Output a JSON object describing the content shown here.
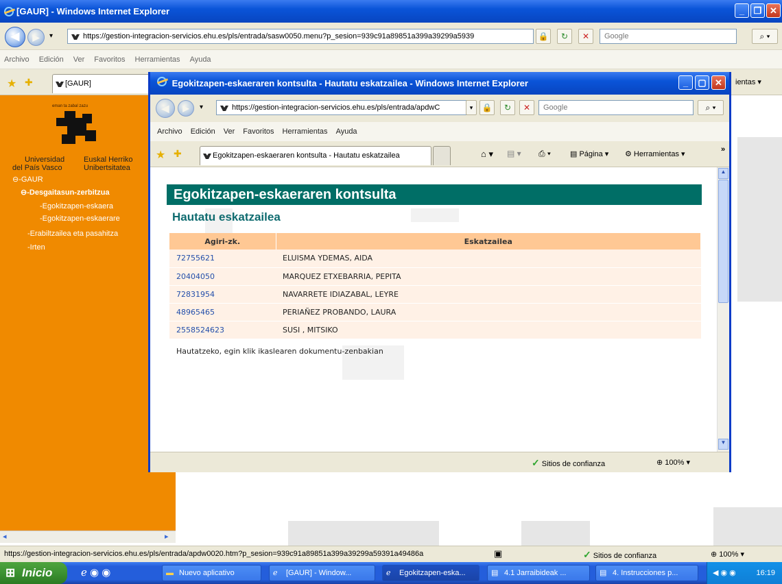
{
  "outer_window": {
    "title": "[GAUR] - Windows Internet Explorer",
    "url": "https://gestion-integracion-servicios.ehu.es/pls/entrada/sasw0050.menu?p_sesion=939c91a89851a399a39299a5939",
    "search_placeholder": "Google",
    "menu": [
      "Archivo",
      "Edición",
      "Ver",
      "Favoritos",
      "Herramientas",
      "Ayuda"
    ],
    "tab_label": "[GAUR]",
    "tools_partial": "ientas"
  },
  "sidebar": {
    "motto": "eman ta zabal zazu",
    "univ_es_1": "Universidad",
    "univ_es_2": "del País Vasco",
    "univ_eu_1": "Euskal Herriko",
    "univ_eu_2": "Unibertsitatea",
    "tree_root": "GAUR",
    "tree_node": "Desgaitasun-zerbitzua",
    "tree_leaf_1": "Egokitzapen-eskaera",
    "tree_leaf_2": "Egokitzapen-eskaerare",
    "tree_item_2": "Erabiltzailea eta pasahitza",
    "tree_item_3": "Irten"
  },
  "popup": {
    "title": "Egokitzapen-eskaeraren kontsulta - Hautatu eskatzailea - Windows Internet Explorer",
    "url": "https://gestion-integracion-servicios.ehu.es/pls/entrada/apdwC",
    "search_placeholder": "Google",
    "menu": [
      "Archivo",
      "Edición",
      "Ver",
      "Favoritos",
      "Herramientas",
      "Ayuda"
    ],
    "tab_label": "Egokitzapen-eskaeraren kontsulta - Hautatu eskatzailea",
    "page_label": "Página",
    "tools_label": "Herramientas",
    "status_zone": "Sitios de confianza",
    "zoom": "100%",
    "heading": "Egokitzapen-eskaeraren kontsulta",
    "subheading": "Hautatu eskatzailea",
    "table": {
      "headers": [
        "Agiri-zk.",
        "Eskatzailea"
      ],
      "rows": [
        {
          "doc": "72755621",
          "name": "ELUISMA YDEMAS, AIDA"
        },
        {
          "doc": "20404050",
          "name": "MARQUEZ ETXEBARRIA, PEPITA"
        },
        {
          "doc": "72831954",
          "name": "NAVARRETE IDIAZABAL, LEYRE"
        },
        {
          "doc": "48965465",
          "name": "PERIAÑEZ PROBANDO, LAURA"
        },
        {
          "doc": "2558524623",
          "name": "SUSI , MITSIKO"
        }
      ]
    },
    "hint": "Hautatzeko, egin klik ikaslearen dokumentu-zenbakian"
  },
  "statusbar": {
    "url": "https://gestion-integracion-servicios.ehu.es/pls/entrada/apdw0020.htm?p_sesion=939c91a89851a399a39299a59391a49486a",
    "zone": "Sitios de confianza",
    "zoom": "100%"
  },
  "taskbar": {
    "start": "Inicio",
    "items": [
      "Nuevo aplicativo",
      "[GAUR] - Window...",
      "Egokitzapen-eska...",
      "4.1 Jarraibideak ...",
      "4. Instrucciones p..."
    ],
    "clock": "16:19"
  },
  "colors": {
    "sidebar_orange": "#f08a00",
    "heading_teal": "#006e66",
    "table_header": "#ffc894",
    "table_row": "#fff1e6",
    "xp_blue": "#0a54d8"
  }
}
